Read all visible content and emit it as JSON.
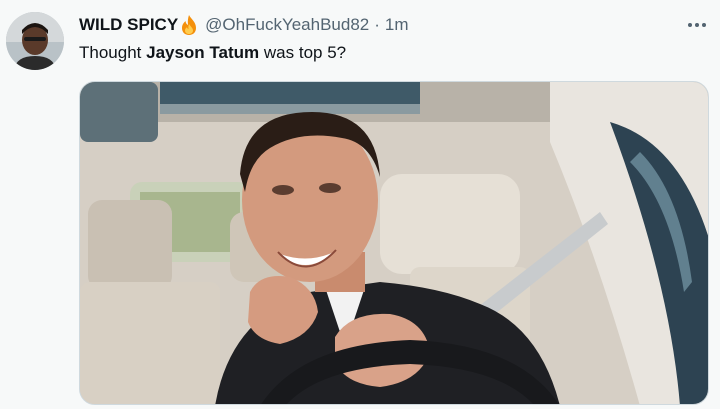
{
  "tweet": {
    "display_name": "WILD SPICY",
    "name_emoji": "fire-emoji",
    "handle": "@OhFuckYeahBud82",
    "separator": "·",
    "time": "1m",
    "more_icon": "more-horizontal-icon",
    "text_before": "Thought ",
    "text_bold": "Jayson Tatum",
    "text_after": " was top 5?"
  },
  "media": {
    "type": "photo"
  },
  "colors": {
    "background": "#f7f9f9",
    "text_primary": "#0f1419",
    "text_secondary": "#536471",
    "border": "#cfd9de"
  }
}
